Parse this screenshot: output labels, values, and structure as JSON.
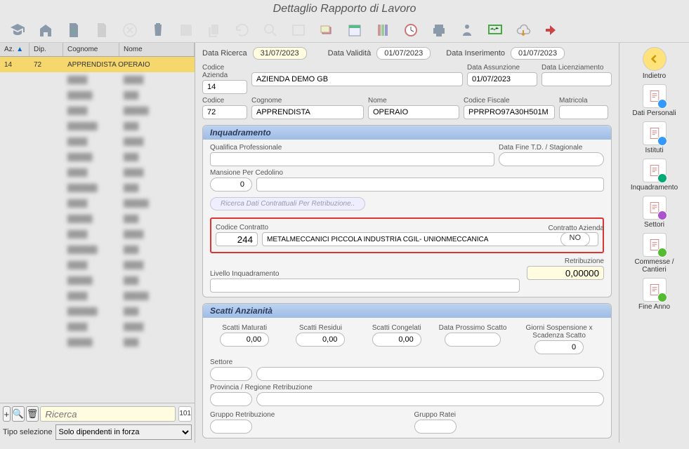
{
  "title": "Dettaglio Rapporto di Lavoro",
  "grid": {
    "headers": {
      "az": "Az.",
      "dip": "Dip.",
      "cognome": "Cognome",
      "nome": "Nome"
    },
    "selected": {
      "az": "14",
      "dip": "72",
      "cognome": "APPRENDISTA",
      "nome": "OPERAIO"
    }
  },
  "search": {
    "placeholder": "Ricerca",
    "count": "101"
  },
  "tiposel": {
    "label": "Tipo selezione",
    "value": "Solo dipendenti in forza"
  },
  "top": {
    "dataRicercaLbl": "Data Ricerca",
    "dataRicerca": "31/07/2023",
    "dataValiditaLbl": "Data Validità",
    "dataValidita": "01/07/2023",
    "dataInserimentoLbl": "Data Inserimento",
    "dataInserimento": "01/07/2023"
  },
  "azienda": {
    "codiceAziendaLbl": "Codice Azienda",
    "codiceAzienda": "14",
    "nomeAzienda": "AZIENDA DEMO GB",
    "dataAssunzioneLbl": "Data Assunzione",
    "dataAssunzione": "01/07/2023",
    "dataLicenziamentoLbl": "Data Licenziamento",
    "dataLicenziamento": ""
  },
  "persona": {
    "codiceLbl": "Codice",
    "codice": "72",
    "cognomeLbl": "Cognome",
    "cognome": "APPRENDISTA",
    "nomeLbl": "Nome",
    "nome": "OPERAIO",
    "cfLbl": "Codice Fiscale",
    "cf": "PPRPRO97A30H501M",
    "matricolaLbl": "Matricola",
    "matricola": ""
  },
  "inq": {
    "title": "Inquadramento",
    "qualificaLbl": "Qualifica Professionale",
    "qualifica": "",
    "dataFineLbl": "Data Fine T.D. / Stagionale",
    "dataFine": "",
    "mansioneLbl": "Mansione Per Cedolino",
    "mansioneCode": "0",
    "mansioneTxt": "",
    "ricercaBtn": "Ricerca Dati Contrattuali Per Retribuzione..",
    "codContrattoLbl": "Codice Contratto",
    "codContratto": "244",
    "contrattoDesc": "METALMECCANICI PICCOLA INDUSTRIA CGIL- UNIONMECCANICA",
    "contrattoAzLbl": "Contratto Azienda",
    "contrattoAz": "NO",
    "livelloLbl": "Livello Inquadramento",
    "livello": "",
    "retribuzioneLbl": "Retribuzione",
    "retribuzione": "0,00000"
  },
  "scatti": {
    "title": "Scatti Anzianità",
    "maturatiLbl": "Scatti Maturati",
    "maturati": "0,00",
    "residuiLbl": "Scatti Residui",
    "residui": "0,00",
    "congelatiLbl": "Scatti Congelati",
    "congelati": "0,00",
    "prossimoLbl": "Data Prossimo Scatto",
    "prossimo": "",
    "sospLbl": "Giorni Sospensione x Scadenza Scatto",
    "sosp": "0",
    "settoreLbl": "Settore",
    "settore": "",
    "provinciaLbl": "Provincia / Regione Retribuzione",
    "provincia": "",
    "gruppoRetrLbl": "Gruppo Retribuzione",
    "gruppoRetr": "",
    "gruppoRateiLbl": "Gruppo Ratei",
    "gruppoRatei": ""
  },
  "nav": {
    "indietro": "Indietro",
    "datiPersonali": "Dati Personali",
    "istituti": "Istituti",
    "inquadramento": "Inquadramento",
    "settori": "Settori",
    "commesse": "Commesse / Cantieri",
    "fineAnno": "Fine Anno"
  }
}
